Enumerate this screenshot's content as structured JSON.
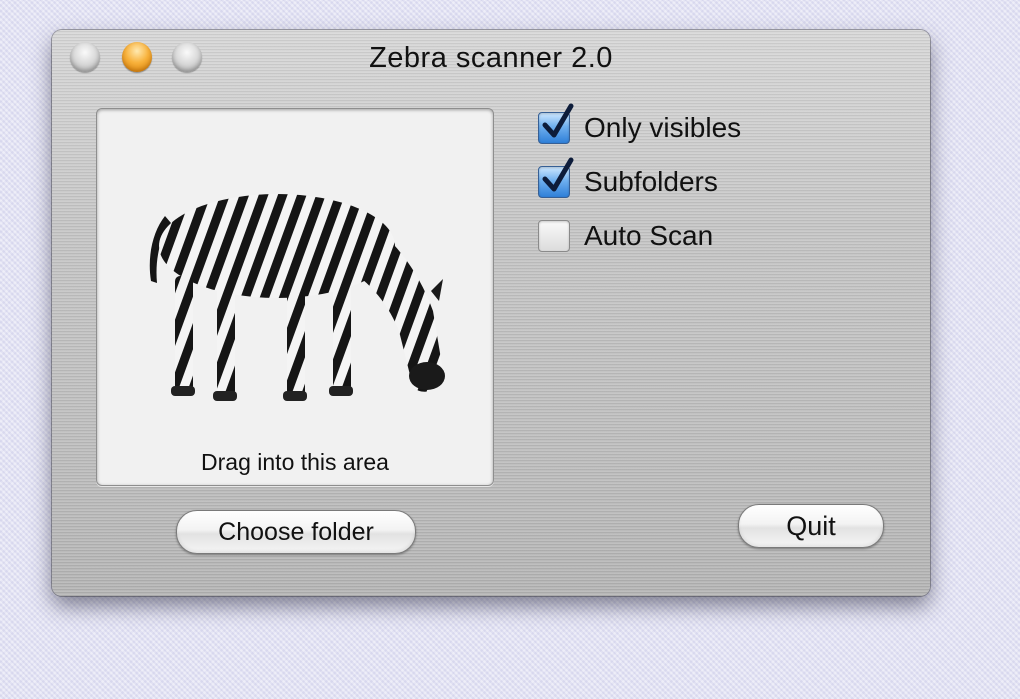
{
  "window": {
    "title": "Zebra scanner 2.0"
  },
  "traffic_lights": {
    "close_color": "#d0d0d0",
    "minimize_color": "#f5a623",
    "zoom_color": "#d0d0d0"
  },
  "drop_area": {
    "label": "Drag into this area",
    "image_icon": "zebra-icon"
  },
  "options": {
    "only_visibles": {
      "label": "Only visibles",
      "checked": true
    },
    "subfolders": {
      "label": "Subfolders",
      "checked": true
    },
    "auto_scan": {
      "label": "Auto Scan",
      "checked": false
    }
  },
  "buttons": {
    "choose_folder": "Choose folder",
    "quit": "Quit"
  }
}
